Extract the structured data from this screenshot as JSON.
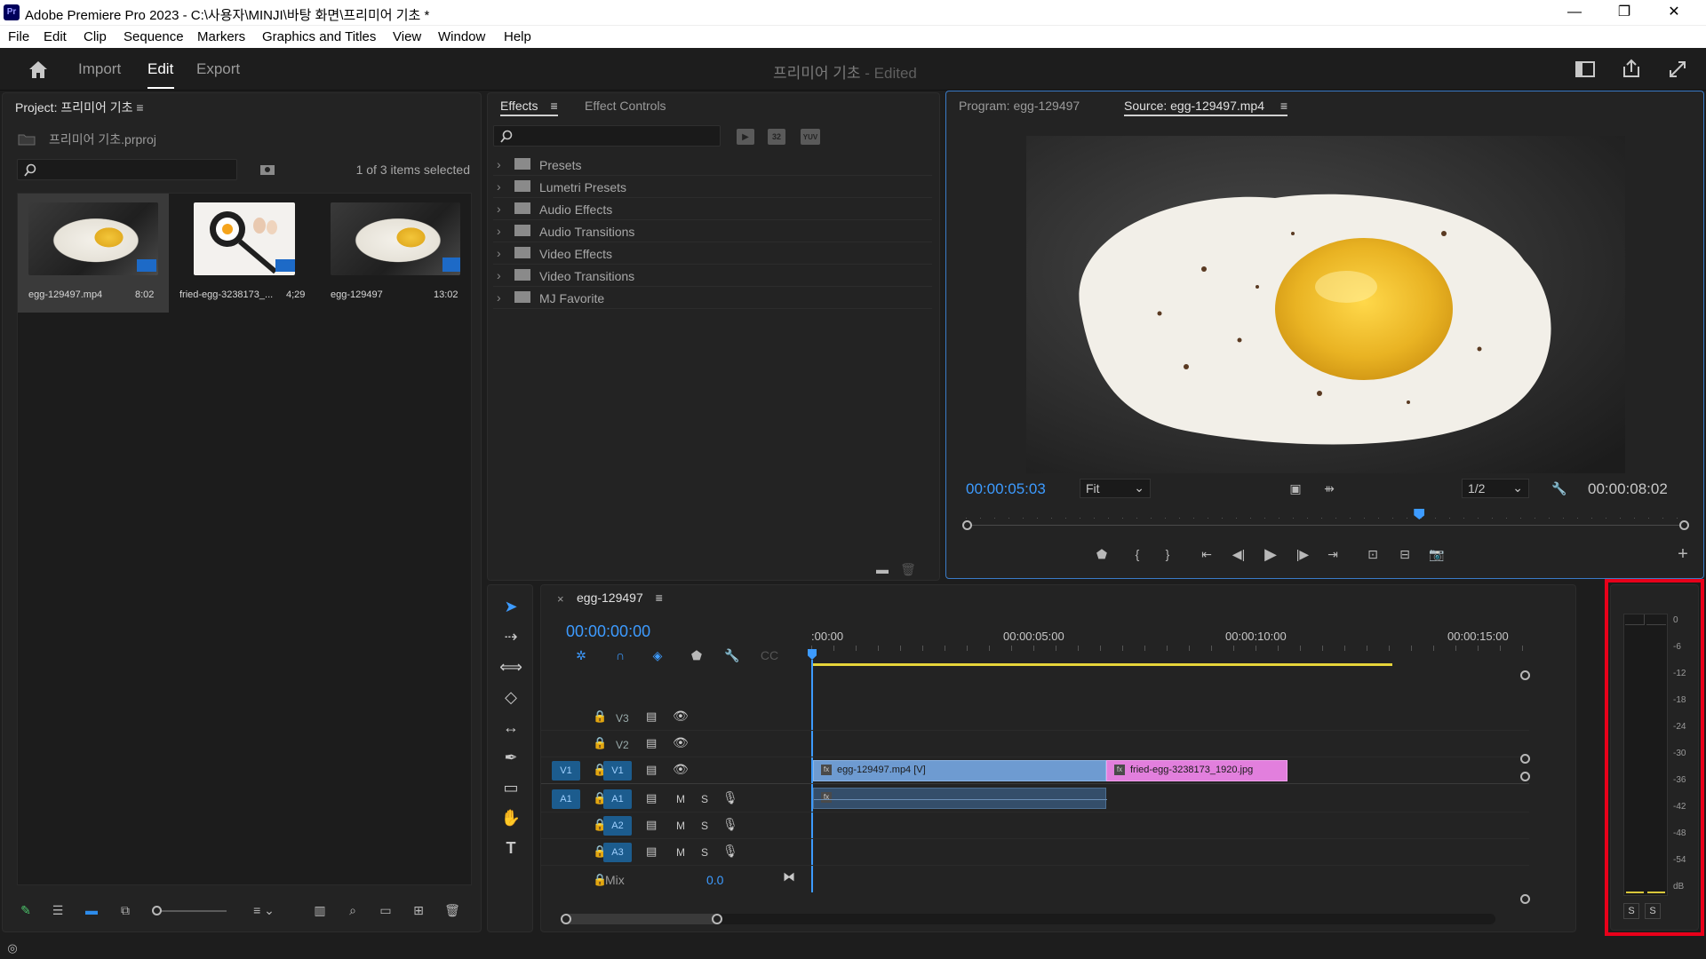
{
  "window": {
    "title": "Adobe Premiere Pro 2023 - C:\\사용자\\MINJI\\바탕 화면\\프리미어 기초 *",
    "app_icon": "Pr",
    "controls": [
      "—",
      "❐",
      "✕"
    ]
  },
  "menu": [
    "File",
    "Edit",
    "Clip",
    "Sequence",
    "Markers",
    "Graphics and Titles",
    "View",
    "Window",
    "Help"
  ],
  "header": {
    "tabs": [
      "Import",
      "Edit",
      "Export"
    ],
    "active_tab": "Edit",
    "project_title": "프리미어 기초",
    "project_status": " - Edited"
  },
  "project_panel": {
    "title": "Project: 프리미어 기초",
    "file": "프리미어 기초.prproj",
    "selection_info": "1 of 3 items selected",
    "items": [
      {
        "name": "egg-129497.mp4",
        "duration": "8:02"
      },
      {
        "name": "fried-egg-3238173_...",
        "duration": "4;29"
      },
      {
        "name": "egg-129497",
        "duration": "13:02"
      }
    ]
  },
  "effects_panel": {
    "tabs": [
      "Effects",
      "Effect Controls"
    ],
    "badges": [
      "32",
      "YUV"
    ],
    "folders": [
      "Presets",
      "Lumetri Presets",
      "Audio Effects",
      "Audio Transitions",
      "Video Effects",
      "Video Transitions",
      "MJ Favorite"
    ]
  },
  "monitor": {
    "tabs": [
      "Program: egg-129497",
      "Source: egg-129497.mp4"
    ],
    "timecode": "00:00:05:03",
    "fit": "Fit",
    "resolution": "1/2",
    "duration": "00:00:08:02",
    "playhead_fraction": 0.63
  },
  "timeline": {
    "sequence": "egg-129497",
    "timecode": "00:00:00:00",
    "ruler": [
      ":00:00",
      "00:00:05:00",
      "00:00:10:00",
      "00:00:15:00"
    ],
    "tracks": {
      "video": [
        "V3",
        "V2",
        "V1"
      ],
      "audio": [
        "A1",
        "A2",
        "A3"
      ],
      "source_v": "V1",
      "source_a": "A1",
      "audio_buttons": [
        "M",
        "S"
      ]
    },
    "mix_label": "Mix",
    "mix_value": "0.0",
    "clips": [
      {
        "name": "egg-129497.mp4 [V]",
        "color": "#6e9bd1"
      },
      {
        "name": "fried-egg-3238173_1920.jpg",
        "color": "#e27fdd"
      }
    ]
  },
  "audio_meter": {
    "scale": [
      "0",
      "-6",
      "-12",
      "-18",
      "-24",
      "-30",
      "-36",
      "-42",
      "-48",
      "-54",
      "dB"
    ],
    "solo": [
      "S",
      "S"
    ],
    "highlight_color": "#e8001a"
  }
}
